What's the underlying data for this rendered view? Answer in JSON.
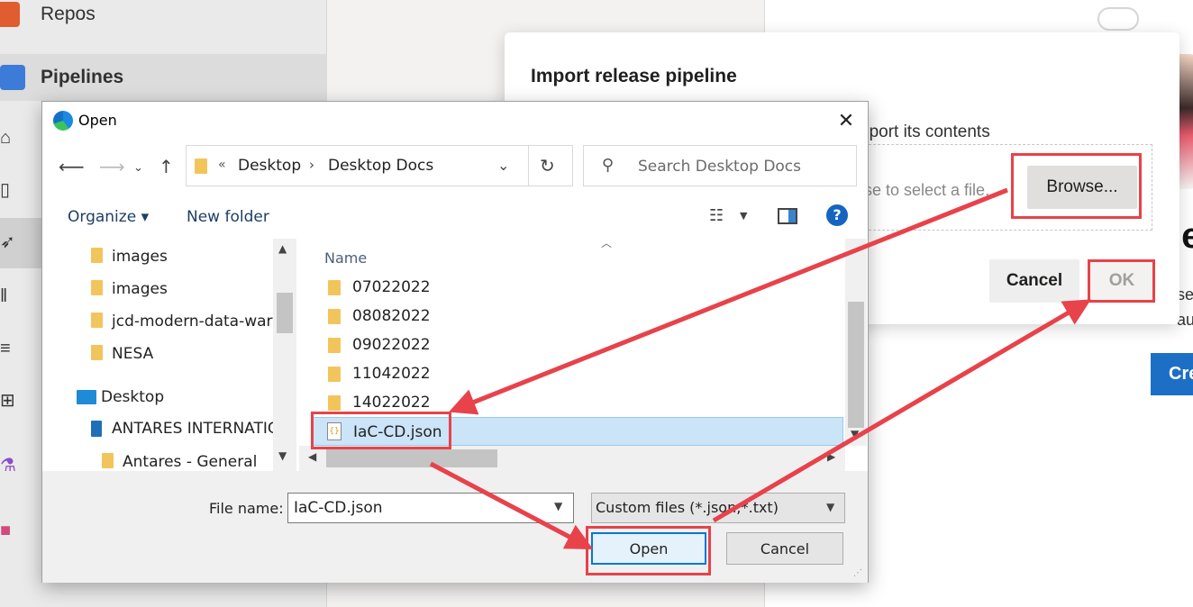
{
  "sidebar": {
    "items": [
      {
        "label": "Repos",
        "icon": "repos-icon"
      },
      {
        "label": "Pipelines",
        "icon": "pipelines-icon"
      }
    ]
  },
  "background_right": {
    "fragment_title": "le",
    "fragment_line1": "se",
    "fragment_line2": "au",
    "create_button": "Cre"
  },
  "import_dialog": {
    "title": "Import release pipeline",
    "description": "nport its contents",
    "drop_text": "se to select a file.",
    "browse_label": "Browse...",
    "cancel_label": "Cancel",
    "ok_label": "OK"
  },
  "open_dialog": {
    "title": "Open",
    "close_glyph": "✕",
    "breadcrumb": [
      "Desktop",
      "Desktop Docs"
    ],
    "crumb_prefix": "«",
    "search_placeholder": "Search Desktop Docs",
    "toolbar": {
      "organize_label": "Organize ▾",
      "new_folder_label": "New folder",
      "help_label": "?"
    },
    "nav_items": [
      {
        "label": "images",
        "type": "folder"
      },
      {
        "label": "images",
        "type": "folder"
      },
      {
        "label": "jcd-modern-data-ware",
        "type": "folder"
      },
      {
        "label": "NESA",
        "type": "folder"
      },
      {
        "label": "Desktop",
        "type": "desktop"
      },
      {
        "label": "ANTARES INTERNATIO",
        "type": "building"
      },
      {
        "label": "Antares - General",
        "type": "folder"
      }
    ],
    "column_name": "Name",
    "files": [
      {
        "name": "07022022",
        "type": "folder"
      },
      {
        "name": "08082022",
        "type": "folder"
      },
      {
        "name": "09022022",
        "type": "folder"
      },
      {
        "name": "11042022",
        "type": "folder"
      },
      {
        "name": "14022022",
        "type": "folder"
      },
      {
        "name": "IaC-CD.json",
        "type": "json",
        "selected": true
      }
    ],
    "file_name_label": "File name:",
    "file_name_value": "IaC-CD.json",
    "file_type_filter": "Custom files (*.json;*.txt)",
    "open_label": "Open",
    "cancel_label": "Cancel"
  },
  "colors": {
    "annotation_red": "#e8424a",
    "accent_blue": "#0078d7",
    "selection_blue": "#cce4f7",
    "folder_yellow": "#f2c55c"
  }
}
